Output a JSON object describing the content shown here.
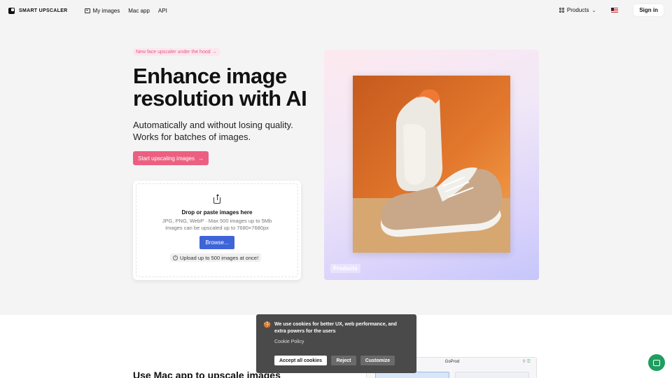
{
  "nav": {
    "brand": "SMART UPSCALER",
    "links": [
      {
        "label": "My images",
        "icon": "image-icon"
      },
      {
        "label": "Mac app"
      },
      {
        "label": "API"
      }
    ],
    "products_label": "Products",
    "signin_label": "Sign in"
  },
  "hero": {
    "badge": "New face upscaler under the hood",
    "badge_arrow": "→",
    "title_line1": "Enhance image",
    "title_line2": "resolution with AI",
    "subtitle_line1": "Automatically and without losing quality.",
    "subtitle_line2": "Works for batches of images.",
    "cta_label": "Start upscaling images",
    "cta_arrow": "→",
    "accent_color": "#ec5f81"
  },
  "upload": {
    "title": "Drop or paste images here",
    "note_line1": "JPG, PNG, WebP · Max 500 images up to 5Mb",
    "note_line2": "Images can be upscaled up to 7680×7680px",
    "browse_label": "Browse...",
    "limit_text": "Upload up to 500 images at once!",
    "button_color": "#3e64d8"
  },
  "showcase": {
    "label": "Products"
  },
  "lower": {
    "title": "Use Mac app to upscale images",
    "mac_window_title": "GoProd"
  },
  "cookie": {
    "emoji": "🍪",
    "text": "We use cookies for better UX, web performance, and extra powers for the users",
    "policy_link": "Cookie Policy",
    "accept_label": "Accept all cookies",
    "reject_label": "Reject",
    "customize_label": "Customize"
  }
}
